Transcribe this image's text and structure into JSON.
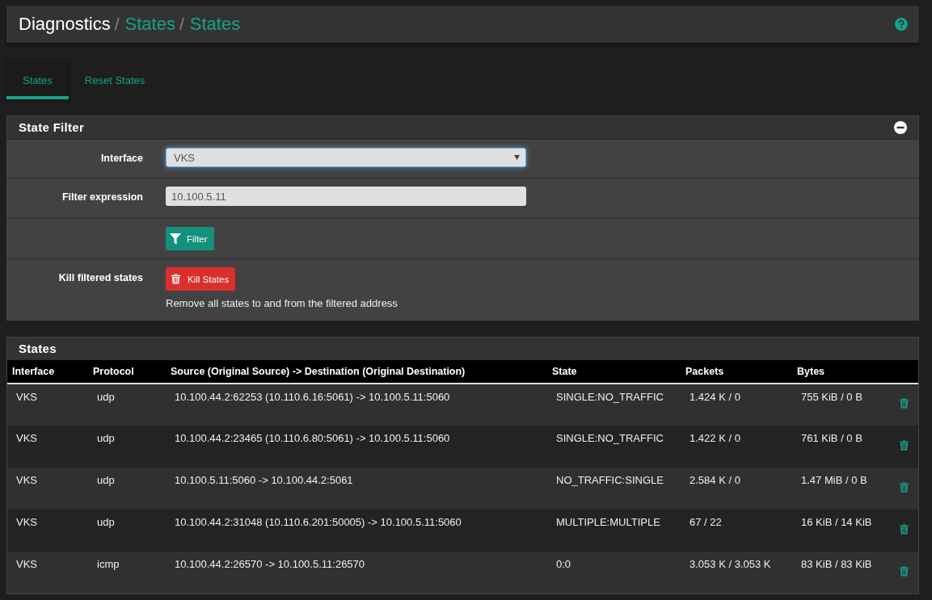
{
  "breadcrumb_separator": "/",
  "breadcrumb": [
    {
      "label": "Diagnostics",
      "link": false
    },
    {
      "label": "States",
      "link": true
    },
    {
      "label": "States",
      "link": true
    }
  ],
  "tabs": [
    {
      "label": "States",
      "selected": true
    },
    {
      "label": "Reset States",
      "selected": false
    }
  ],
  "filter_panel": {
    "title": "State Filter",
    "interface": {
      "label": "Interface",
      "value": "VKS"
    },
    "filter_expression": {
      "label": "Filter expression",
      "value": "10.100.5.11"
    },
    "filter_button": "Filter",
    "kill": {
      "label": "Kill filtered states",
      "button": "Kill States",
      "help": "Remove all states to and from the filtered address"
    }
  },
  "states_panel": {
    "title": "States",
    "columns": [
      "Interface",
      "Protocol",
      "Source (Original Source) -> Destination (Original Destination)",
      "State",
      "Packets",
      "Bytes"
    ],
    "rows": [
      {
        "interface": "VKS",
        "protocol": "udp",
        "flow": "10.100.44.2:62253 (10.110.6.16:5061) -> 10.100.5.11:5060",
        "state": "SINGLE:NO_TRAFFIC",
        "packets": "1.424 K / 0",
        "bytes": "755 KiB / 0 B"
      },
      {
        "interface": "VKS",
        "protocol": "udp",
        "flow": "10.100.44.2:23465 (10.110.6.80:5061) -> 10.100.5.11:5060",
        "state": "SINGLE:NO_TRAFFIC",
        "packets": "1.422 K / 0",
        "bytes": "761 KiB / 0 B"
      },
      {
        "interface": "VKS",
        "protocol": "udp",
        "flow": "10.100.5.11:5060 -> 10.100.44.2:5061",
        "state": "NO_TRAFFIC:SINGLE",
        "packets": "2.584 K / 0",
        "bytes": "1.47 MiB / 0 B"
      },
      {
        "interface": "VKS",
        "protocol": "udp",
        "flow": "10.100.44.2:31048 (10.110.6.201:50005) -> 10.100.5.11:5060",
        "state": "MULTIPLE:MULTIPLE",
        "packets": "67 / 22",
        "bytes": "16 KiB / 14 KiB"
      },
      {
        "interface": "VKS",
        "protocol": "icmp",
        "flow": "10.100.44.2:26570 -> 10.100.5.11:26570",
        "state": "0:0",
        "packets": "3.053 K / 3.053 K",
        "bytes": "83 KiB / 83 KiB"
      }
    ]
  }
}
